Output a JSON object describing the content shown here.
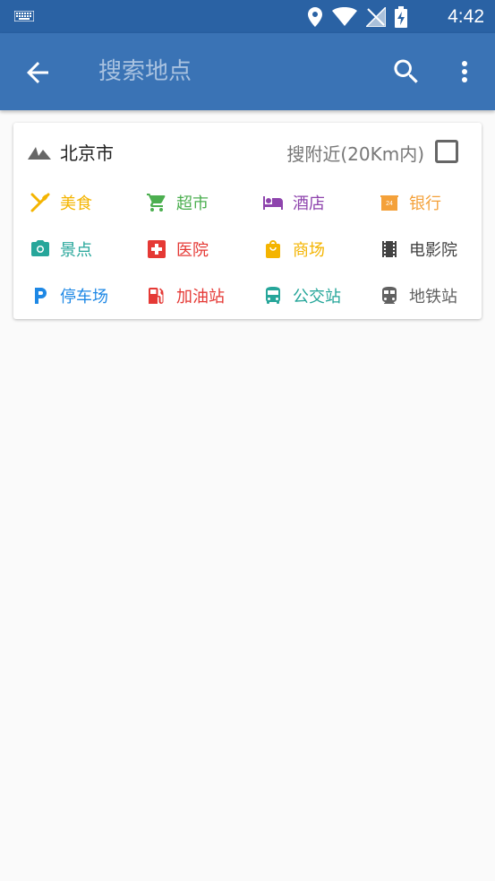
{
  "status_bar": {
    "time": "4:42"
  },
  "app_bar": {
    "search_placeholder": "搜索地点"
  },
  "card": {
    "city": "北京市",
    "nearby_label": "搜附近(20Km内)",
    "categories": [
      {
        "label": "美食",
        "icon": "food-icon",
        "color": "#f4b400"
      },
      {
        "label": "超市",
        "icon": "cart-icon",
        "color": "#4caf50"
      },
      {
        "label": "酒店",
        "icon": "hotel-icon",
        "color": "#8e44ad"
      },
      {
        "label": "银行",
        "icon": "bank-icon",
        "color": "#f4a13a"
      },
      {
        "label": "景点",
        "icon": "camera-icon",
        "color": "#26a69a"
      },
      {
        "label": "医院",
        "icon": "hospital-icon",
        "color": "#e53935"
      },
      {
        "label": "商场",
        "icon": "shopping-bag-icon",
        "color": "#f4b400"
      },
      {
        "label": "电影院",
        "icon": "film-icon",
        "color": "#424242"
      },
      {
        "label": "停车场",
        "icon": "parking-icon",
        "color": "#1e88e5"
      },
      {
        "label": "加油站",
        "icon": "gas-station-icon",
        "color": "#e53935"
      },
      {
        "label": "公交站",
        "icon": "bus-icon",
        "color": "#26a69a"
      },
      {
        "label": "地铁站",
        "icon": "subway-icon",
        "color": "#616161"
      }
    ]
  }
}
